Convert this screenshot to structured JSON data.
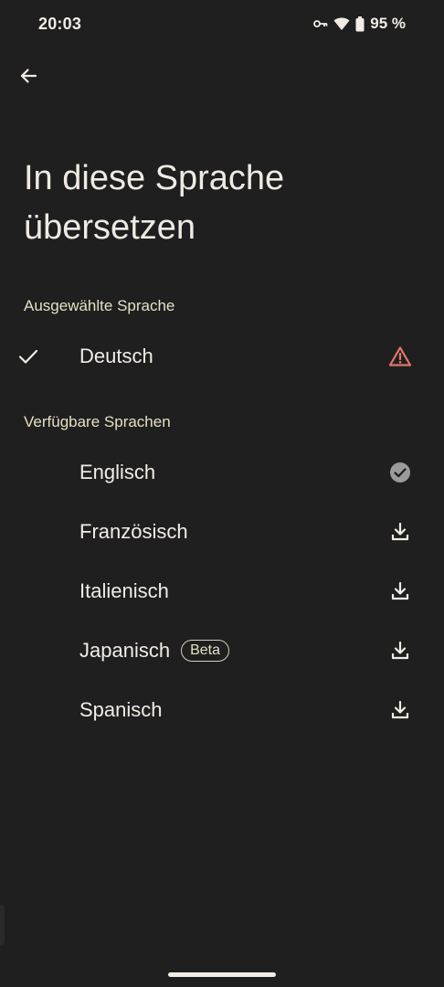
{
  "status_bar": {
    "time": "20:03",
    "battery": "95 %",
    "icons": [
      "vpn-key-icon",
      "wifi-icon",
      "battery-icon"
    ]
  },
  "toolbar": {
    "back_icon": "arrow-left-icon"
  },
  "page": {
    "title_line1": "In diese Sprache",
    "title_line2": "übersetzen"
  },
  "selected_section": {
    "header": "Ausgewählte Sprache",
    "item": {
      "label": "Deutsch",
      "leading_icon": "checkmark-icon",
      "trailing_icon": "warning-triangle-icon"
    }
  },
  "available_section": {
    "header": "Verfügbare Sprachen",
    "items": [
      {
        "label": "Englisch",
        "trailing_icon": "downloaded-check-icon"
      },
      {
        "label": "Französisch",
        "trailing_icon": "download-icon"
      },
      {
        "label": "Italienisch",
        "trailing_icon": "download-icon"
      },
      {
        "label": "Japanisch",
        "badge": "Beta",
        "trailing_icon": "download-icon"
      },
      {
        "label": "Spanisch",
        "trailing_icon": "download-icon"
      }
    ]
  },
  "colors": {
    "background": "#1f1f1f",
    "text": "#f1ede6",
    "section_header": "#e7dfc4",
    "warning": "#e0776b",
    "downloaded": "#9b9b9b"
  }
}
